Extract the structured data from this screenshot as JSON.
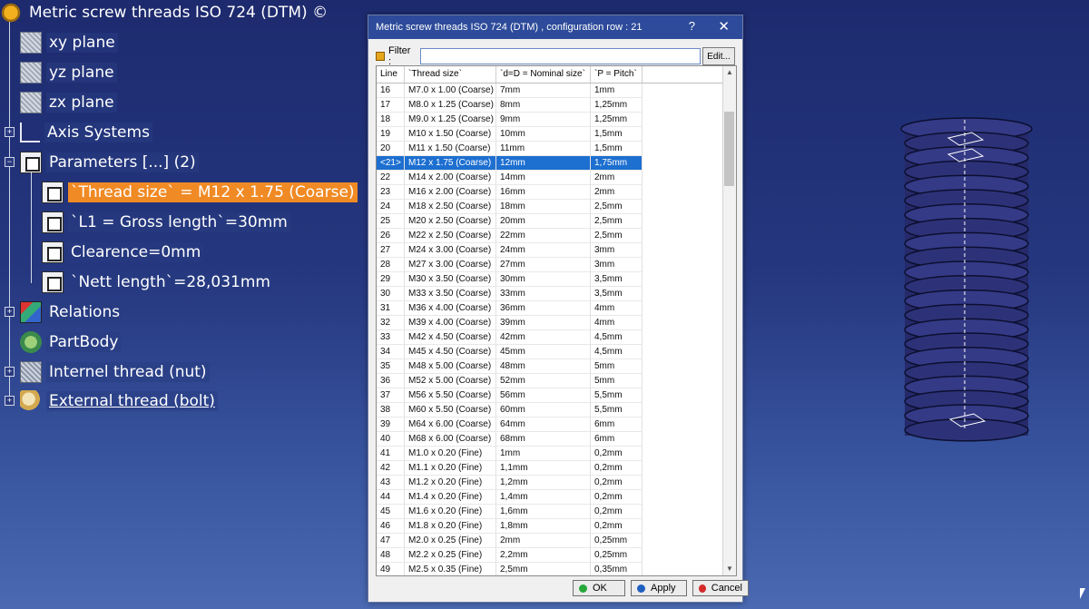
{
  "tree": {
    "root": "Metric screw threads ISO 724 (DTM) ©",
    "planes": [
      "xy plane",
      "yz plane",
      "zx plane"
    ],
    "axis_systems": "Axis Systems",
    "parameters": "Parameters [...] (2)",
    "params": [
      "`Thread size` = M12 x 1.75 (Coarse)",
      "`L1 = Gross length`=30mm",
      "Clearence=0mm",
      "`Nett length`=28,031mm"
    ],
    "relations": "Relations",
    "partbody": "PartBody",
    "internal": "Internel thread (nut)",
    "external": "External thread (bolt)"
  },
  "dialog": {
    "title": "Metric screw threads ISO 724 (DTM) , configuration row : 21",
    "help": "?",
    "close": "✕",
    "filter_label": "Filter :",
    "filter_value": "",
    "edit_label": "Edit...",
    "columns": [
      "Line",
      "`Thread size`",
      "`d=D = Nominal size`",
      "`P = Pitch`"
    ],
    "rows": [
      [
        "16",
        "M7.0 x 1.00 (Coarse)",
        "7mm",
        "1mm"
      ],
      [
        "17",
        "M8.0 x 1.25 (Coarse)",
        "8mm",
        "1,25mm"
      ],
      [
        "18",
        "M9.0 x 1.25 (Coarse)",
        "9mm",
        "1,25mm"
      ],
      [
        "19",
        "M10 x 1.50 (Coarse)",
        "10mm",
        "1,5mm"
      ],
      [
        "20",
        "M11 x 1.50 (Coarse)",
        "11mm",
        "1,5mm"
      ],
      [
        "<21>",
        "M12 x 1.75 (Coarse)",
        "12mm",
        "1,75mm"
      ],
      [
        "22",
        "M14 x 2.00 (Coarse)",
        "14mm",
        "2mm"
      ],
      [
        "23",
        "M16 x 2.00 (Coarse)",
        "16mm",
        "2mm"
      ],
      [
        "24",
        "M18 x 2.50 (Coarse)",
        "18mm",
        "2,5mm"
      ],
      [
        "25",
        "M20 x 2.50 (Coarse)",
        "20mm",
        "2,5mm"
      ],
      [
        "26",
        "M22 x 2.50 (Coarse)",
        "22mm",
        "2,5mm"
      ],
      [
        "27",
        "M24 x 3.00 (Coarse)",
        "24mm",
        "3mm"
      ],
      [
        "28",
        "M27 x 3.00 (Coarse)",
        "27mm",
        "3mm"
      ],
      [
        "29",
        "M30 x 3.50 (Coarse)",
        "30mm",
        "3,5mm"
      ],
      [
        "30",
        "M33 x 3.50 (Coarse)",
        "33mm",
        "3,5mm"
      ],
      [
        "31",
        "M36 x 4.00 (Coarse)",
        "36mm",
        "4mm"
      ],
      [
        "32",
        "M39 x 4.00 (Coarse)",
        "39mm",
        "4mm"
      ],
      [
        "33",
        "M42 x 4.50 (Coarse)",
        "42mm",
        "4,5mm"
      ],
      [
        "34",
        "M45 x 4.50 (Coarse)",
        "45mm",
        "4,5mm"
      ],
      [
        "35",
        "M48 x 5.00 (Coarse)",
        "48mm",
        "5mm"
      ],
      [
        "36",
        "M52 x 5.00 (Coarse)",
        "52mm",
        "5mm"
      ],
      [
        "37",
        "M56 x 5.50 (Coarse)",
        "56mm",
        "5,5mm"
      ],
      [
        "38",
        "M60 x 5.50 (Coarse)",
        "60mm",
        "5,5mm"
      ],
      [
        "39",
        "M64 x 6.00 (Coarse)",
        "64mm",
        "6mm"
      ],
      [
        "40",
        "M68 x 6.00 (Coarse)",
        "68mm",
        "6mm"
      ],
      [
        "41",
        "M1.0 x 0.20 (Fine)",
        "1mm",
        "0,2mm"
      ],
      [
        "42",
        "M1.1 x 0.20 (Fine)",
        "1,1mm",
        "0,2mm"
      ],
      [
        "43",
        "M1.2 x 0.20 (Fine)",
        "1,2mm",
        "0,2mm"
      ],
      [
        "44",
        "M1.4 x 0.20 (Fine)",
        "1,4mm",
        "0,2mm"
      ],
      [
        "45",
        "M1.6 x 0.20 (Fine)",
        "1,6mm",
        "0,2mm"
      ],
      [
        "46",
        "M1.8 x 0.20 (Fine)",
        "1,8mm",
        "0,2mm"
      ],
      [
        "47",
        "M2.0 x 0.25 (Fine)",
        "2mm",
        "0,25mm"
      ],
      [
        "48",
        "M2.2 x 0.25 (Fine)",
        "2,2mm",
        "0,25mm"
      ],
      [
        "49",
        "M2.5 x 0.35 (Fine)",
        "2,5mm",
        "0,35mm"
      ]
    ],
    "selected_row": "<21>",
    "ok_label": "OK",
    "apply_label": "Apply",
    "cancel_label": "Cancel"
  },
  "colors": {
    "selection": "#1d6fd0",
    "tree_selected": "#f08a24",
    "ok": "#27a83a",
    "apply": "#1f5fc0",
    "cancel": "#d42a2a"
  }
}
